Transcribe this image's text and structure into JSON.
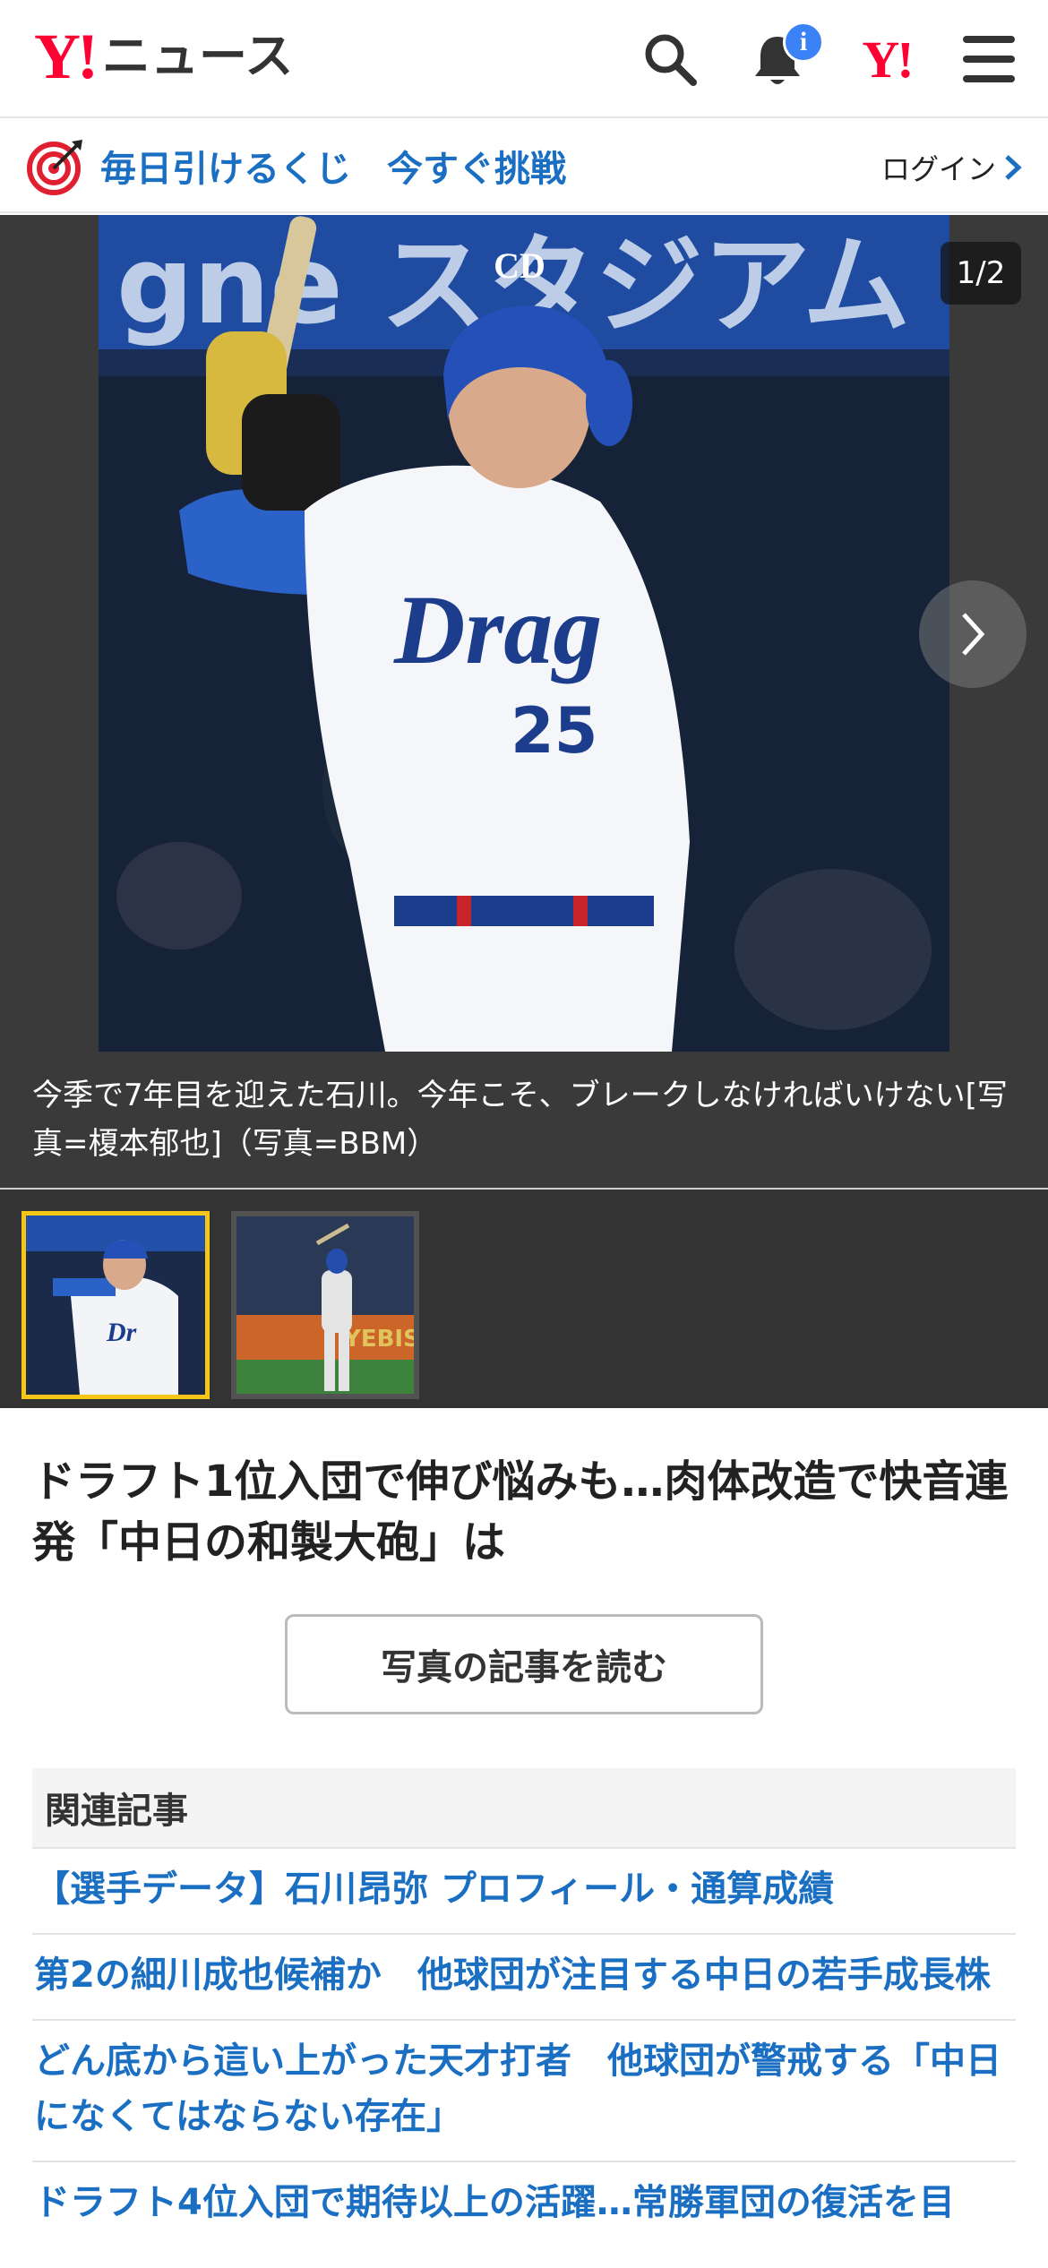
{
  "header": {
    "logo_mark": "Y!",
    "logo_text": "ニュース",
    "icons": [
      "search-icon",
      "bell-icon",
      "yahoo-mini-logo",
      "menu-icon"
    ],
    "notification_badge": "i",
    "yahoo_mini": "Y!"
  },
  "promo": {
    "icon": "target-dart-icon",
    "text": "毎日引けるくじ　今すぐ挑戦",
    "login_label": "ログイン"
  },
  "gallery": {
    "counter": "1/2",
    "caption": "今季で7年目を迎えた石川。今年こそ、ブレークしなければいけない[写真=榎本郁也]（写真=BBM）",
    "thumbnails": [
      "thumbnail-1",
      "thumbnail-2"
    ],
    "selected_index": 0
  },
  "article": {
    "headline": "ドラフト1位入団で伸び悩みも…肉体改造で快音連発「中日の和製大砲」は",
    "read_button": "写真の記事を読む"
  },
  "related": {
    "heading": "関連記事",
    "items": [
      "【選手データ】石川昂弥 プロフィール・通算成績",
      "第2の細川成也候補か　他球団が注目する中日の若手成長株",
      "どん底から這い上がった天才打者　他球団が警戒する「中日になくてはならない存在」",
      "ドラフト4位入団で期待以上の活躍…常勝軍団の復活を目"
    ]
  },
  "colors": {
    "brand_red": "#ff0033",
    "link_blue": "#1a6fc2",
    "badge_blue": "#3b82f6",
    "thumb_selected": "#f5c518"
  }
}
